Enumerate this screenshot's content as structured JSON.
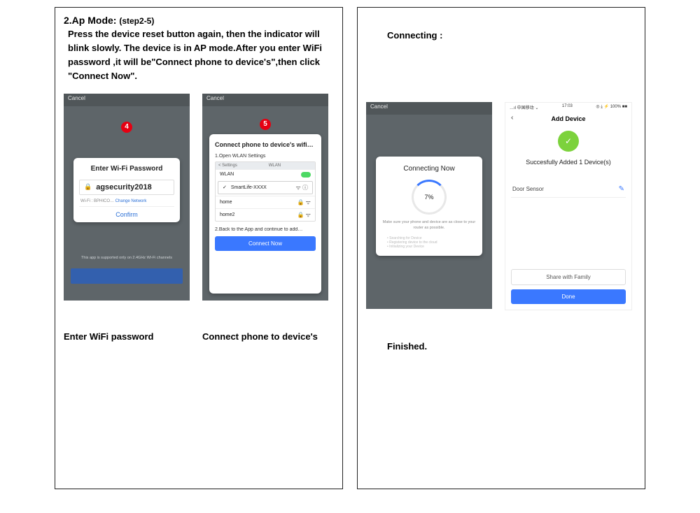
{
  "left": {
    "title_main": "2.Ap Mode: ",
    "title_sub": "(step2-5)",
    "body": "Press the device reset button again, then the indicator will blink slowly. The device is in AP mode.After you enter WiFi password ,it will be\"Connect phone to device's\",then click \"Connect Now\".",
    "phone4": {
      "cancel": "Cancel",
      "badge": "4",
      "title": "Enter Wi-Fi Password",
      "ssid": "agsecurity2018",
      "sub_prefix": "Wi-Fi : BPHICO…",
      "change": "Change Network",
      "confirm": "Confirm",
      "foot": "This app is supported only on 2.4GHz Wi-Fi channels"
    },
    "phone5": {
      "cancel": "Cancel",
      "badge": "5",
      "title": "Connect phone to device's wifi…",
      "step1": "1.Open WLAN Settings",
      "wlan_hdr_l": "< Settings",
      "wlan_hdr_r": "WLAN",
      "rows": [
        {
          "name": "WLAN",
          "toggle": true
        },
        {
          "name": "SmartLife-XXXX",
          "sel": true
        },
        {
          "name": "home",
          "sig": true
        },
        {
          "name": "home2",
          "sig": true
        }
      ],
      "step2": "2.Back to the App and continue to add…",
      "connect_now": "Connect Now"
    },
    "caption4": "Enter WiFi password",
    "caption5": "Connect phone to device's"
  },
  "right": {
    "heading": "Connecting :",
    "phoneC": {
      "cancel": "Cancel",
      "title": "Connecting Now",
      "percent": "7%",
      "tip": "Make sure your phone and device are as close to your router as possible.",
      "list": [
        "Searching for Device",
        "Registering device to the cloud",
        "Initializing your Device"
      ]
    },
    "phoneF": {
      "status_l": "…ıl 中国移动 ⌄",
      "status_c": "17:03",
      "status_r": "◎ ⤓ ⚡ 100% ■■",
      "back": "‹",
      "header": "Add Device",
      "check": "✓",
      "success": "Succesfully Added 1 Device(s)",
      "device": "Door Sensor",
      "pencil": "✎",
      "share": "Share with Family",
      "done": "Done"
    },
    "finished": "Finished."
  }
}
